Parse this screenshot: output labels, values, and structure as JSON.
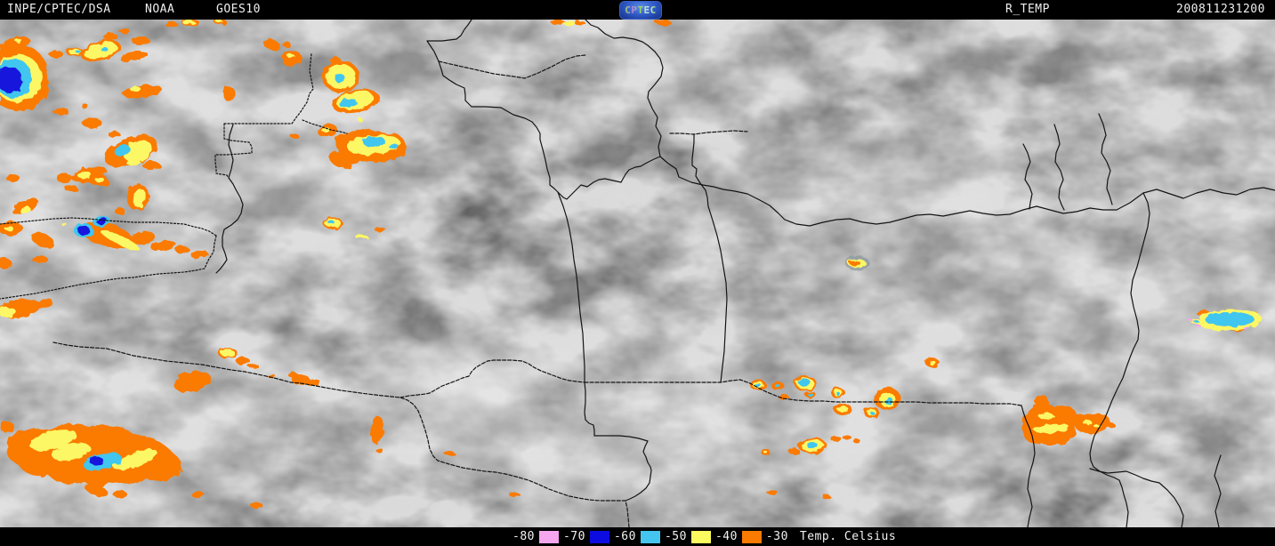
{
  "header": {
    "agency": "INPE/CPTEC/DSA",
    "operator": "NOAA",
    "satellite": "GOES10",
    "logo": "CPTEC",
    "product": "R_TEMP",
    "timestamp": "200811231200"
  },
  "legend": {
    "title": "Temp. Celsius",
    "labels": [
      "-80",
      "-70",
      "-60",
      "-50",
      "-40",
      "-30"
    ],
    "swatches": [
      "#f6a6ee",
      "#0c0ce0",
      "#44c5ee",
      "#fbfb60",
      "#fb7a00"
    ]
  },
  "palette": {
    "enhancement_orange": "#fb7a00",
    "enhancement_yellow": "#fbf765",
    "enhancement_cyan": "#41c6ef",
    "enhancement_blue": "#1318dd",
    "enhancement_pink": "#f6a6ee",
    "bar_background": "#000000",
    "bar_text": "#efefef"
  }
}
